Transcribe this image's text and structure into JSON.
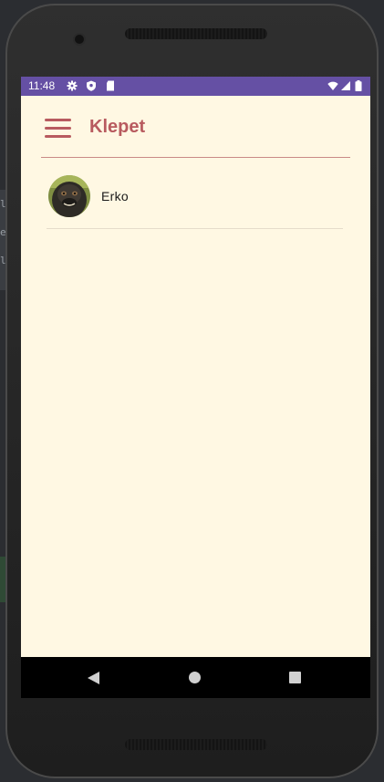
{
  "status_bar": {
    "time": "11:48",
    "left_icons": [
      "gear-icon",
      "shield-icon",
      "sd-card-icon"
    ],
    "right_icons": [
      "wifi-icon",
      "signal-icon",
      "battery-icon"
    ],
    "color": "#6550a4"
  },
  "app_bar": {
    "title": "Klepet",
    "menu_icon": "hamburger-menu-icon",
    "accent_color": "#b85b5f"
  },
  "chats": [
    {
      "name": "Erko",
      "avatar": "monkey-avatar"
    }
  ],
  "nav_bar": {
    "buttons": [
      "back-icon",
      "home-icon",
      "recents-icon"
    ]
  },
  "colors": {
    "background": "#fff8e3",
    "accent": "#b85b5f",
    "status_bar": "#6550a4"
  }
}
